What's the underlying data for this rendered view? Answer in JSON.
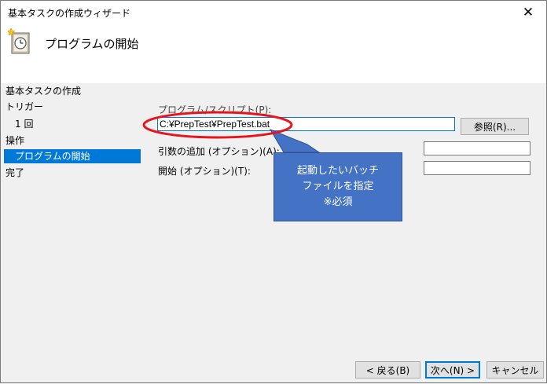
{
  "window": {
    "title": "基本タスクの作成ウィザード",
    "close_glyph": "✕"
  },
  "header": {
    "title": "プログラムの開始",
    "icon": "task-scheduler-clock-icon"
  },
  "nav": {
    "items": [
      {
        "label": "基本タスクの作成"
      },
      {
        "label": "トリガー"
      },
      {
        "label": "1 回"
      },
      {
        "label": "操作"
      },
      {
        "label": "プログラムの開始"
      },
      {
        "label": "完了"
      }
    ]
  },
  "form": {
    "program_label": "プログラム/スクリプト(P):",
    "program_value": "C:¥PrepTest¥PrepTest.bat",
    "browse_label": "参照(R)...",
    "args_label": "引数の追加 (オプション)(A):",
    "args_value": "",
    "start_label": "開始 (オプション)(T):",
    "start_value": ""
  },
  "annotation": {
    "line1": "起動したいバッチ",
    "line2": "ファイルを指定",
    "line3": "※必須",
    "highlight_color": "#e8141b",
    "callout_color": "#4472c4"
  },
  "footer": {
    "back_label": "< 戻る(B)",
    "next_label": "次へ(N) >",
    "cancel_label": "キャンセル"
  }
}
